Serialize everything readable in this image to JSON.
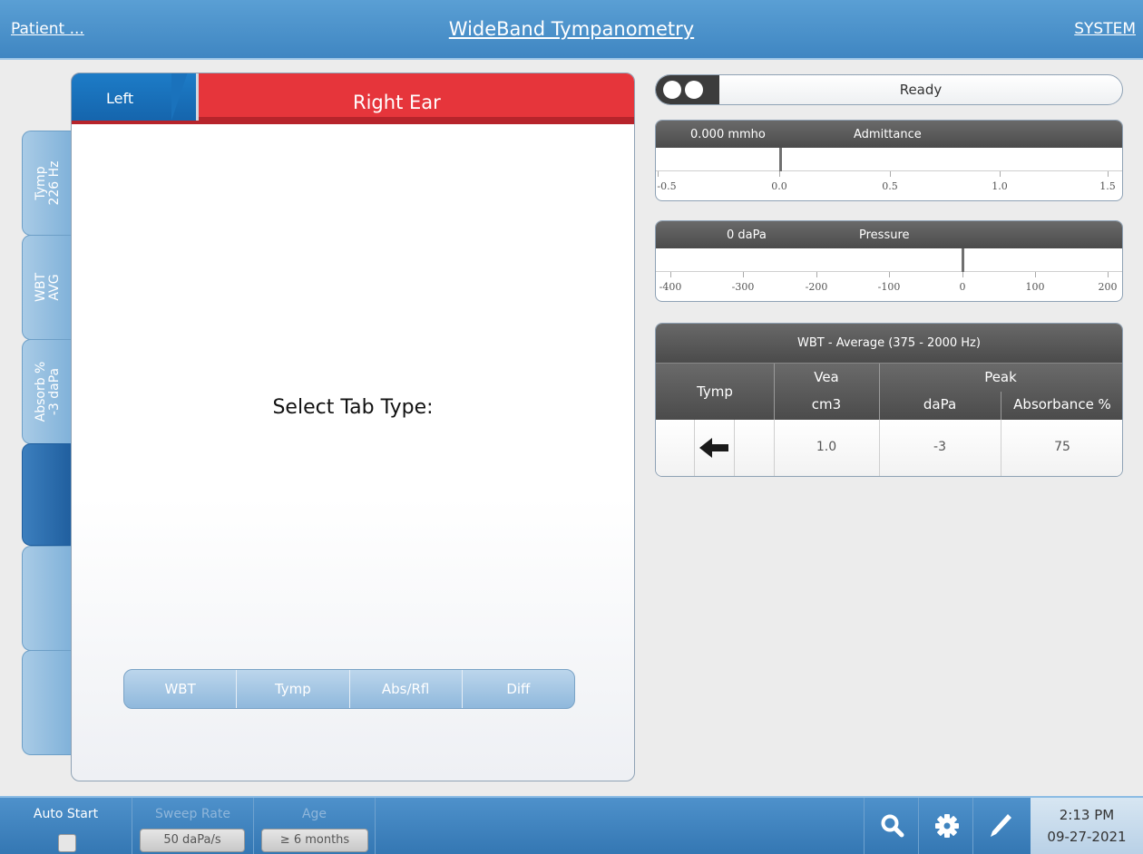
{
  "header": {
    "patient_link": "Patient ...",
    "title": "WideBand Tympanometry",
    "system_link": "SYSTEM"
  },
  "side_tabs": [
    {
      "line1": "Tymp",
      "line2": "226 Hz"
    },
    {
      "line1": "WBT",
      "line2": "AVG"
    },
    {
      "line1": "Absorb %",
      "line2": "-3 daPa"
    },
    {
      "line1": "",
      "line2": ""
    },
    {
      "line1": "",
      "line2": ""
    },
    {
      "line1": "",
      "line2": ""
    }
  ],
  "ear": {
    "left_label": "Left",
    "right_label": "Right Ear"
  },
  "main": {
    "select_label": "Select Tab Type:",
    "tab_types": [
      "WBT",
      "Tymp",
      "Abs/Rfl",
      "Diff"
    ]
  },
  "status": {
    "text": "Ready"
  },
  "admittance": {
    "value": "0.000 mmho",
    "name": "Admittance",
    "ticks": [
      "-0.5",
      "0.0",
      "0.5",
      "1.0",
      "1.5"
    ]
  },
  "pressure": {
    "value": "0 daPa",
    "name": "Pressure",
    "ticks": [
      "-400",
      "-300",
      "-200",
      "-100",
      "0",
      "100",
      "200"
    ]
  },
  "results": {
    "title": "WBT - Average (375 - 2000 Hz)",
    "col_tymp": "Tymp",
    "col_vea": "Vea",
    "col_vea_unit": "cm3",
    "col_peak": "Peak",
    "col_dapa": "daPa",
    "col_absorbance": "Absorbance %",
    "row": {
      "vea": "1.0",
      "dapa": "-3",
      "absorbance": "75"
    }
  },
  "footer": {
    "auto_start": "Auto Start",
    "sweep_rate_label": "Sweep Rate",
    "sweep_rate_value": "50 daPa/s",
    "age_label": "Age",
    "age_value": "≥ 6 months",
    "time": "2:13 PM",
    "date": "09-27-2021"
  }
}
